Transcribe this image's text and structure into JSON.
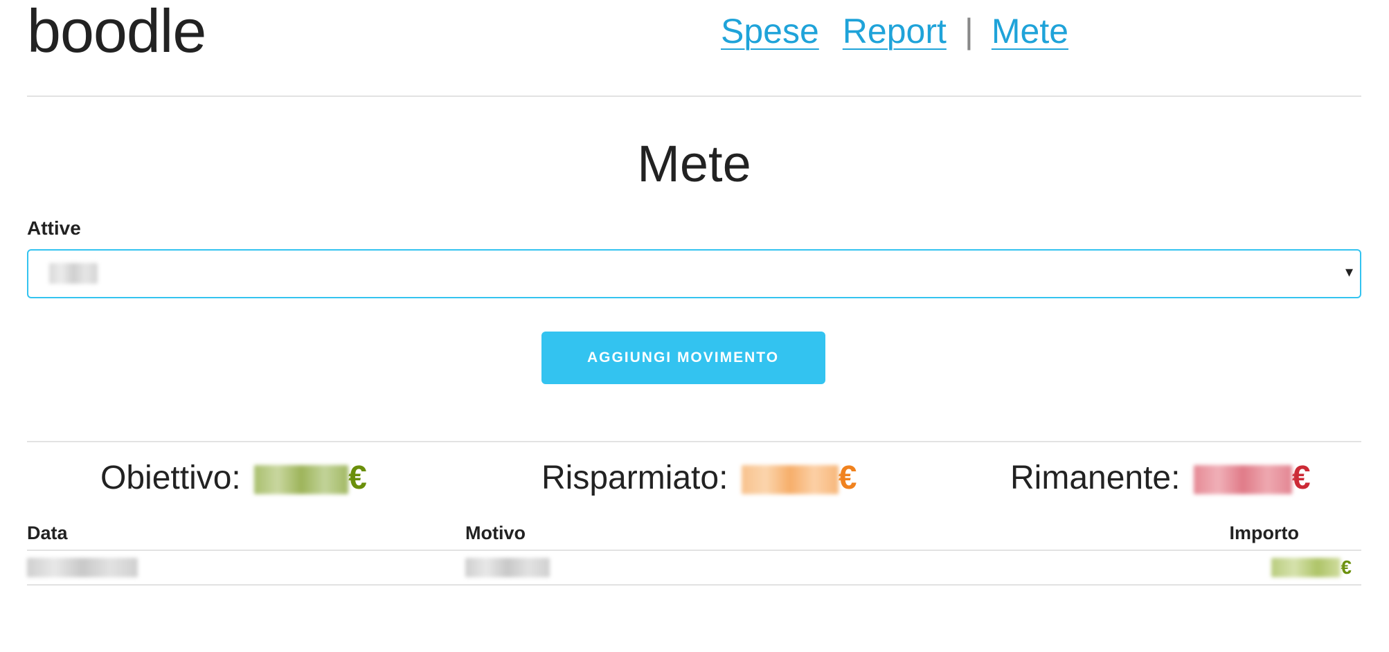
{
  "header": {
    "logo": "boodle",
    "nav": {
      "spese": "Spese",
      "report": "Report",
      "separator": "|",
      "mete": "Mete"
    }
  },
  "page": {
    "title": "Mete"
  },
  "form": {
    "active_label": "Attive",
    "select_caret": "▾",
    "add_button": "Aggiungi movimento"
  },
  "stats": {
    "objective_label": "Obiettivo:",
    "saved_label": "Risparmiato:",
    "remaining_label": "Rimanente:",
    "currency": "€"
  },
  "table": {
    "columns": [
      "Data",
      "Motivo",
      "Importo"
    ],
    "rows": [
      {
        "currency": "€"
      }
    ]
  },
  "colors": {
    "accent": "#33c3f0",
    "link": "#1fa3d9",
    "objective": "#6a8f0a",
    "saved": "#f0821e",
    "remaining": "#cc2a36"
  }
}
